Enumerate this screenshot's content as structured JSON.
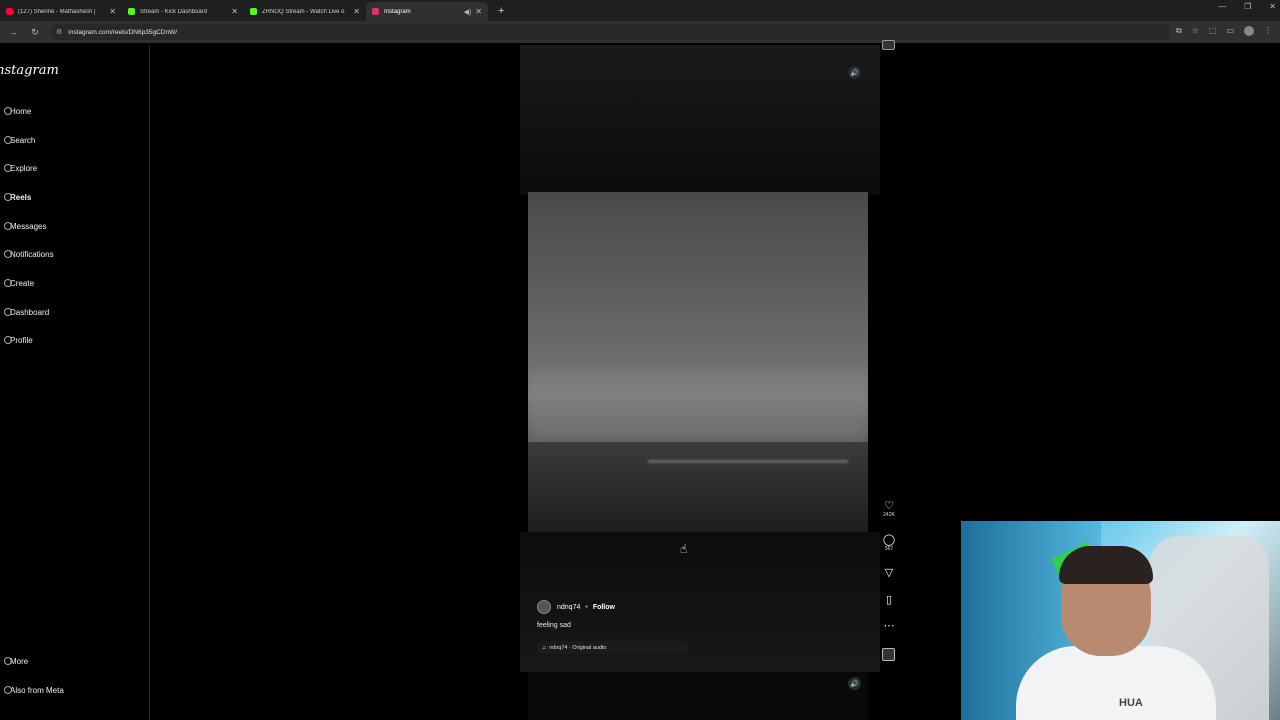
{
  "browser": {
    "tabs": [
      {
        "title": "(127) Sherine - Mathashesh |",
        "favicon_color": "#ff0033",
        "active": false
      },
      {
        "title": "Stream - Kick Dashboard",
        "favicon_color": "#53fc18",
        "active": false
      },
      {
        "title": "ZRNOQ Stream - Watch Live o",
        "favicon_color": "#53fc18",
        "active": false
      },
      {
        "title": "Instagram",
        "favicon_color": "#e1306c",
        "active": true
      }
    ],
    "url": "instagram.com/reels/DN6p35gCDnW/"
  },
  "sidebar": {
    "logo": "Instagram",
    "items": [
      {
        "label": "Home",
        "bold": false
      },
      {
        "label": "Search",
        "bold": false
      },
      {
        "label": "Explore",
        "bold": false
      },
      {
        "label": "Reels",
        "bold": true
      },
      {
        "label": "Messages",
        "bold": false
      },
      {
        "label": "Notifications",
        "bold": false
      },
      {
        "label": "Create",
        "bold": false
      },
      {
        "label": "Dashboard",
        "bold": false
      },
      {
        "label": "Profile",
        "bold": false
      }
    ],
    "bottom": [
      {
        "label": "More"
      },
      {
        "label": "Also from Meta"
      }
    ]
  },
  "reel": {
    "author": "ndnq74",
    "follow_label": "Follow",
    "caption": "feeling sad",
    "audio": "ndnq74 · Original audio",
    "likes": "242K",
    "comments": "567"
  },
  "webcam": {
    "shirt_text": "HUA"
  }
}
